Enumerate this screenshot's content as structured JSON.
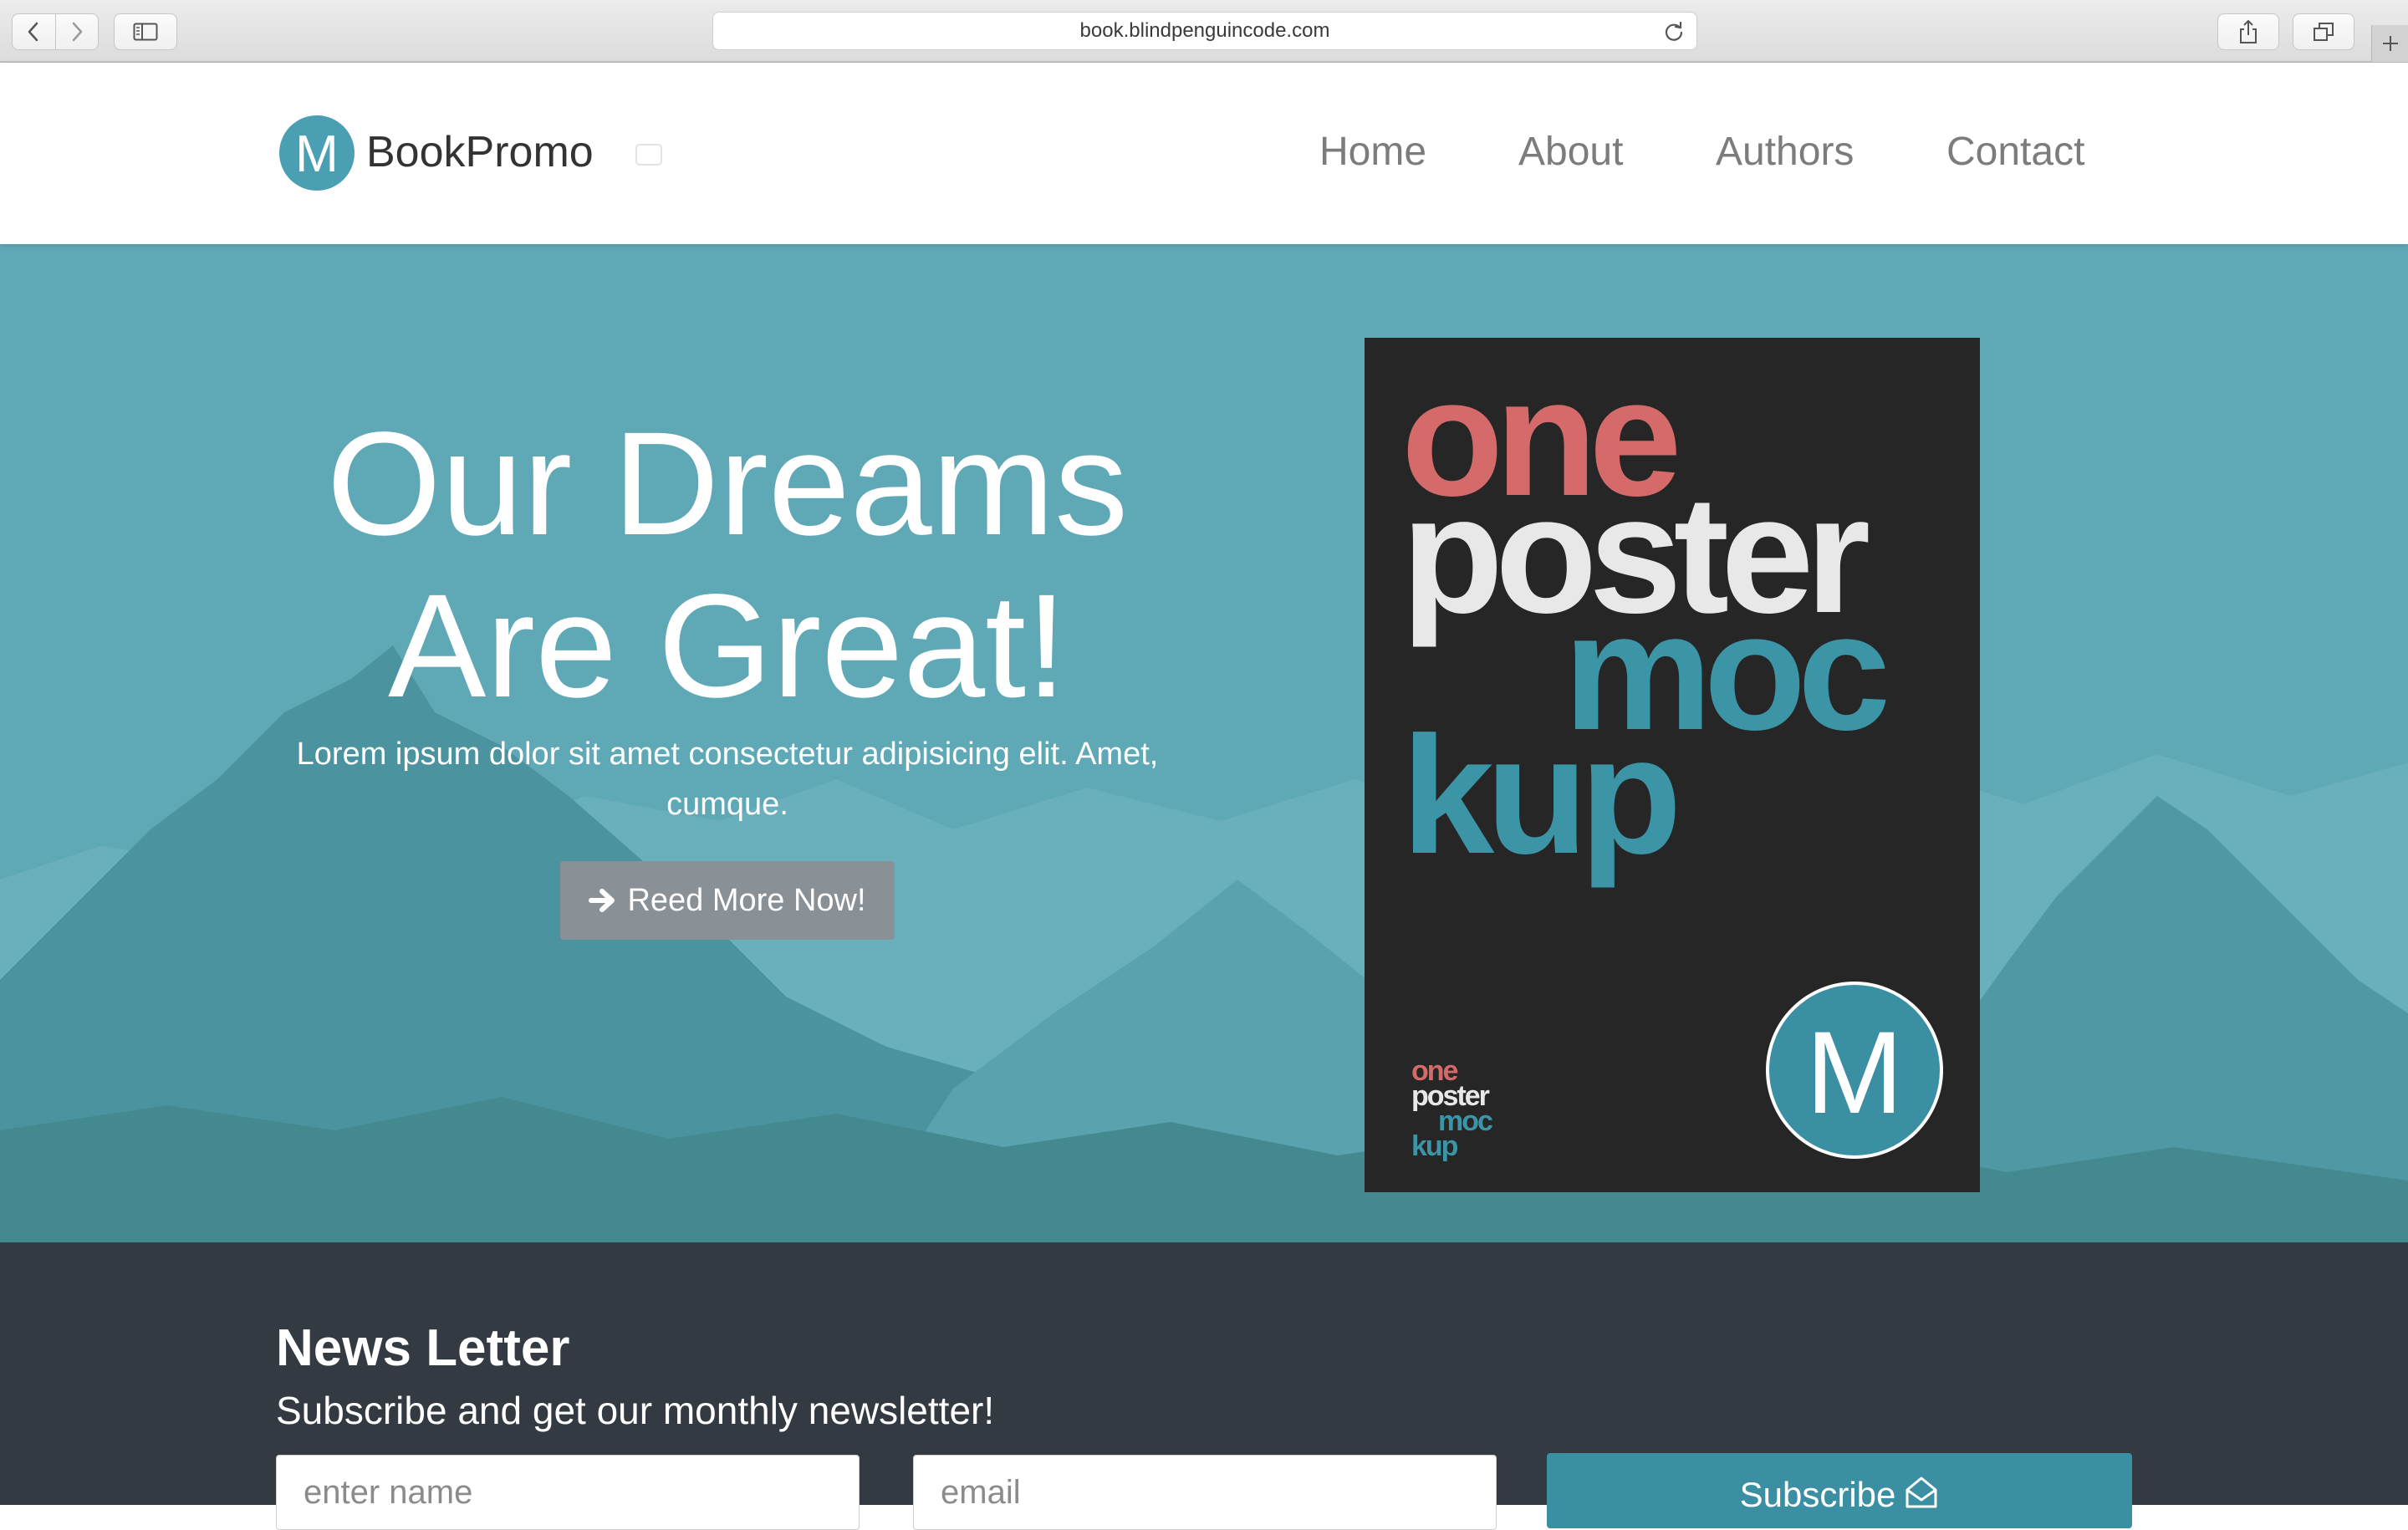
{
  "browser": {
    "url": "book.blindpenguincode.com",
    "icons": [
      "back-icon",
      "forward-icon",
      "sidebar-icon",
      "reload-icon",
      "share-icon",
      "tabs-icon",
      "plus-icon"
    ]
  },
  "navbar": {
    "logo_letter": "M",
    "brand": "BookPromo",
    "links": {
      "home": "Home",
      "about": "About",
      "authors": "Authors",
      "contact": "Contact"
    }
  },
  "hero": {
    "title_line1": "Our Dreams",
    "title_line2": "Are Great!",
    "subtitle": "Lorem ipsum dolor sit amet consectetur adipisicing elit. Amet, cumque.",
    "button_label": "Reed More Now!",
    "button_icon": "arrow-right-icon"
  },
  "poster": {
    "word1": "one",
    "word2": "poster",
    "word3": "moc",
    "word4": "kup",
    "badge_letter": "M"
  },
  "newsletter": {
    "heading": "News Letter",
    "subheading": "Subscribe and get our monthly newsletter!",
    "name_placeholder": "enter name",
    "email_placeholder": "email",
    "subscribe_label": "Subscribe",
    "subscribe_icon": "envelope-open-icon"
  },
  "colors": {
    "accent": "#3a8fa2",
    "hero_overlay": "#5fa8b6",
    "poster_red": "#d46a6a",
    "poster_teal": "#3b95a6",
    "footer_bg": "#343a42",
    "button_gray": "#8a9196"
  }
}
